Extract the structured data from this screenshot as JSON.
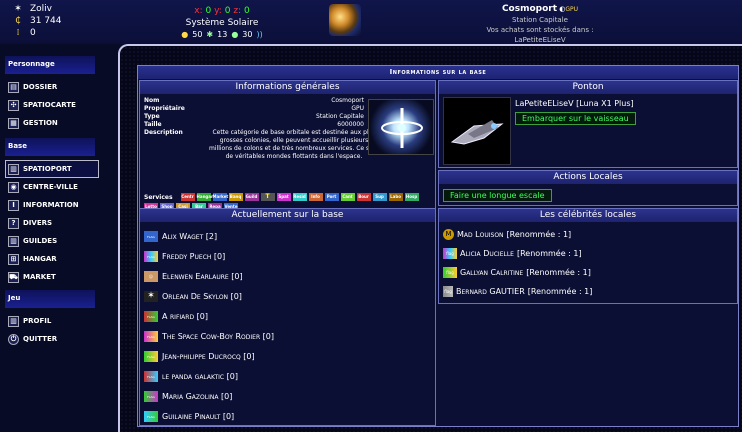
{
  "player": {
    "name": "Zoliv",
    "credits": "31 744",
    "points": "0"
  },
  "location": {
    "x_label": "x:",
    "x": "0",
    "y_label": "y:",
    "y": "0",
    "z_label": "z:",
    "z": "0",
    "system": "Système Solaire",
    "stat_a": "50",
    "stat_b": "13",
    "stat_c": "30"
  },
  "base": {
    "name": "Cosmoport",
    "owner_tag": "GPU",
    "station": "Station Capitale",
    "storage": "Vos achats sont stockés dans : LaPetiteELiseV"
  },
  "sidebar": {
    "sections": [
      {
        "title": "Personnage",
        "items": [
          "Dossier",
          "Spatiocarte",
          "Gestion"
        ]
      },
      {
        "title": "Base",
        "items": [
          "Spatioport",
          "centre-ville",
          "information",
          "divers",
          "guildes",
          "hangar",
          "market"
        ]
      },
      {
        "title": "Jeu",
        "items": [
          "Profil",
          "Quitter"
        ]
      }
    ],
    "active": "Spatioport"
  },
  "panel": {
    "title": "Informations sur la base"
  },
  "general": {
    "title": "Informations générales",
    "rows": [
      {
        "k": "Nom",
        "v": "Cosmoport"
      },
      {
        "k": "Propriétaire",
        "v": "GPU"
      },
      {
        "k": "Type",
        "v": "Station Capitale"
      },
      {
        "k": "Taille",
        "v": "6000000"
      }
    ],
    "desc_label": "Description",
    "desc": "Cette catégorie de base orbitale est destinée aux plus grosses colonies, elle peuvent accueillir plusieurs millions de colons et de très nombreux services. Ce sont de véritables mondes flottants dans l'espace.",
    "services_label": "Services",
    "services": [
      "Centr",
      "Hangar",
      "Market",
      "Banq",
      "Guild",
      "T",
      "Spat",
      "Resid",
      "Info",
      "Port",
      "Cant",
      "Bour",
      "Sup",
      "Labo",
      "Hosp",
      "Lotto",
      "Shop",
      "Casi",
      "Bar",
      "Repa",
      "Vente"
    ]
  },
  "ponton": {
    "title": "Ponton",
    "ship": "LaPetiteELiseV [Luna X1 Plus]",
    "board_btn": "Embarquer sur le vaisseau"
  },
  "actions": {
    "title": "Actions Locales",
    "btn": "Faire une longue escale"
  },
  "present": {
    "title": "Actuellement sur la base",
    "people": [
      "Alix Waget [2]",
      "Freddy Puech [0]",
      "Elenwen Earlaure [0]",
      "Orlean De Skylon [0]",
      "A rifiard [0]",
      "The Space Cow-Boy Rodier [0]",
      "Jean-philippe Ducrocq [0]",
      "le panda galaktic [0]",
      "Maria Gazolina [0]",
      "Guilaine Pinault [0]"
    ]
  },
  "celebs": {
    "title": "Les célébrités locales",
    "list": [
      {
        "name": "Mad Louison",
        "fame": "[Renommée : 1]"
      },
      {
        "name": "Alicia Ducielle",
        "fame": "[Renommée : 1]"
      },
      {
        "name": "Gallyan Calritine",
        "fame": "[Renommée : 1]"
      },
      {
        "name": "Bernard GAUTIER",
        "fame": "[Renommée : 1]"
      }
    ]
  }
}
